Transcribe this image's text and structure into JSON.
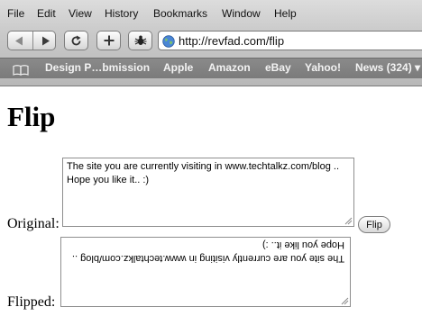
{
  "menu": {
    "file": "File",
    "edit": "Edit",
    "view": "View",
    "history": "History",
    "bookmarks": "Bookmarks",
    "window": "Window",
    "help": "Help"
  },
  "toolbar": {
    "back_icon": "back-arrow-icon",
    "forward_icon": "forward-arrow-icon",
    "reload_icon": "reload-icon",
    "add_bookmark_icon": "plus-icon",
    "debug_icon": "bug-icon",
    "url": "http://revfad.com/flip"
  },
  "bookmarks_bar": {
    "items": [
      "Design P…bmission",
      "Apple",
      "Amazon",
      "eBay",
      "Yahoo!",
      "News (324) ▾"
    ]
  },
  "page": {
    "title": "Flip",
    "original_label": "Original:",
    "flipped_label": "Flipped:",
    "original_text": "The site you are currently visiting in www.techtalkz.com/blog .. Hope you like it.. :)",
    "flipped_text": "The site you are currently visiting in www.techtalkz.com/blog .. Hope you like it.. :)",
    "flip_button": "Flip"
  }
}
